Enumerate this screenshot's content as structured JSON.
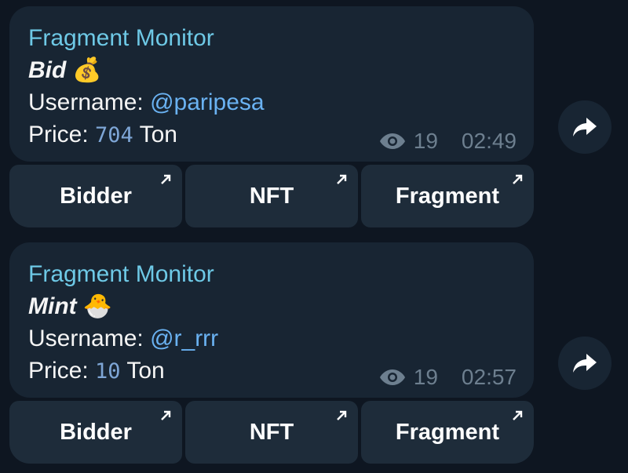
{
  "messages": [
    {
      "sender": "Fragment Monitor",
      "title": "Bid",
      "title_emoji": "💰",
      "username_label": "Username: ",
      "username": "@paripesa",
      "price_label": "Price: ",
      "price": "704",
      "price_unit": " Ton",
      "views": "19",
      "time": "02:49",
      "buttons": [
        "Bidder",
        "NFT",
        "Fragment"
      ]
    },
    {
      "sender": "Fragment Monitor",
      "title": "Mint",
      "title_emoji": "🐣",
      "username_label": "Username: ",
      "username": "@r_rrr",
      "price_label": "Price: ",
      "price": "10",
      "price_unit": " Ton",
      "views": "19",
      "time": "02:57",
      "buttons": [
        "Bidder",
        "NFT",
        "Fragment"
      ]
    }
  ],
  "icons": {
    "views": "eye-icon",
    "link": "external-link-arrow-icon",
    "share": "forward-arrow-icon"
  },
  "colors": {
    "background": "#0e1621",
    "bubble": "#182533",
    "sender": "#6ec9e6",
    "mention": "#6ab2f2",
    "button": "#1e2c3a"
  }
}
